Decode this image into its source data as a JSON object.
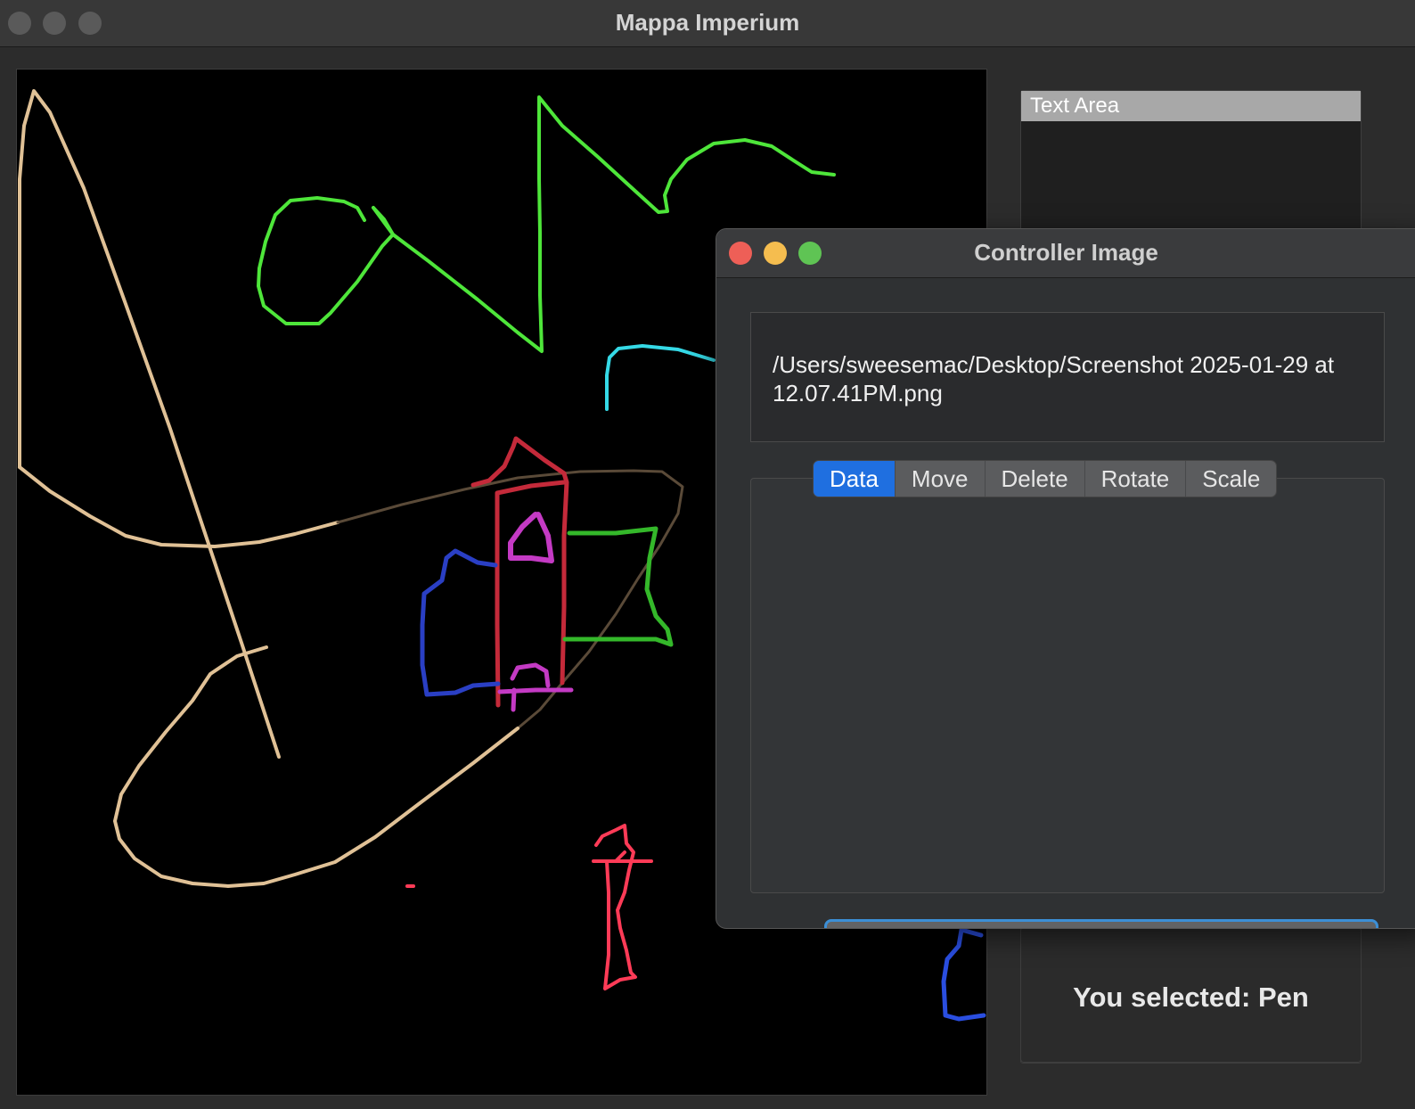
{
  "main_window": {
    "title": "Mappa Imperium"
  },
  "side_panel": {
    "text_area_label": "Text Area",
    "selected_text": "You selected: Pen"
  },
  "controller": {
    "title": "Controller Image",
    "file_path": "/Users/sweesemac/Desktop/Screenshot 2025-01-29 at 12.07.41PM.png",
    "tabs": [
      {
        "label": "Data",
        "active": true
      },
      {
        "label": "Move",
        "active": false
      },
      {
        "label": "Delete",
        "active": false
      },
      {
        "label": "Rotate",
        "active": false
      },
      {
        "label": "Scale",
        "active": false
      }
    ],
    "data_button_label": "Data"
  },
  "colors": {
    "tab_active": "#1f6fe0",
    "stroke_tan": "#e0c196",
    "stroke_green": "#4ee63a",
    "stroke_cyan": "#35d9e6",
    "stroke_red": "#c42a3a",
    "stroke_magenta": "#c43ac4",
    "stroke_blue": "#2a3fc4",
    "stroke_darkgreen": "#34b82a",
    "stroke_pink": "#ff3b57"
  }
}
